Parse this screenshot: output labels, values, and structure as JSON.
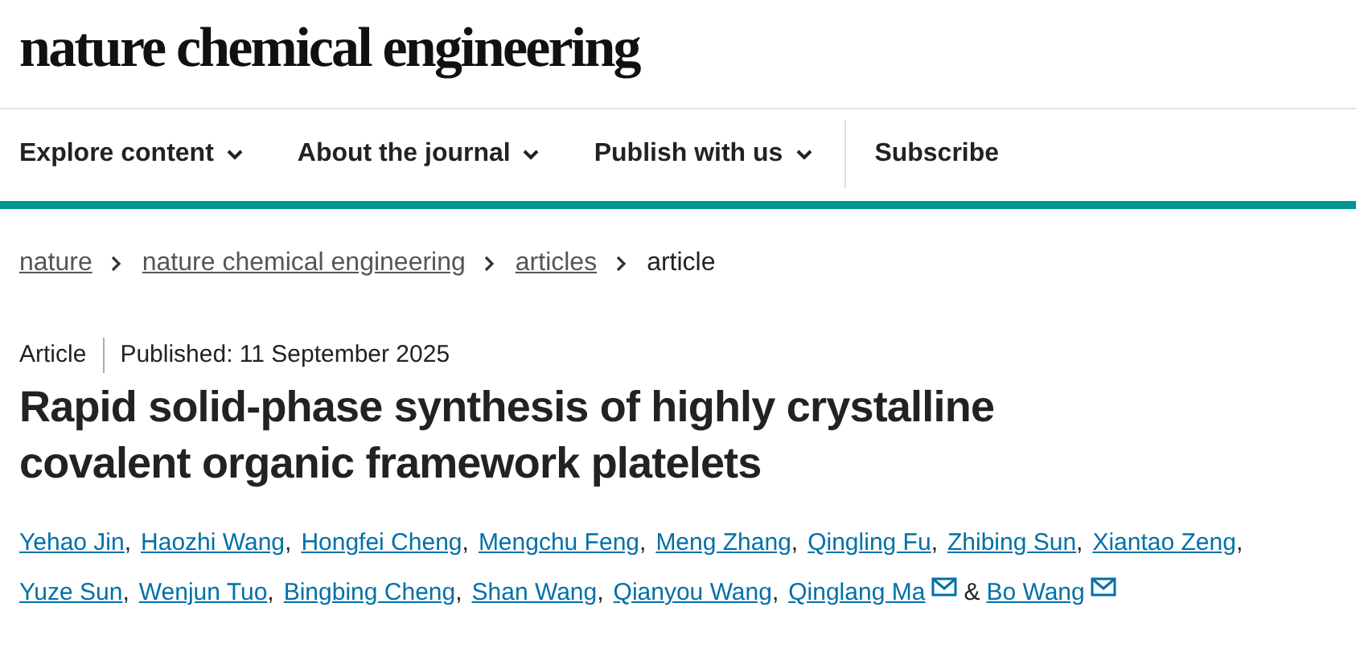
{
  "logo": "nature chemical engineering",
  "nav": [
    {
      "label": "Explore content",
      "kind": "dropdown"
    },
    {
      "label": "About the journal",
      "kind": "dropdown"
    },
    {
      "label": "Publish with us",
      "kind": "dropdown"
    },
    {
      "label": "Subscribe",
      "kind": "link"
    }
  ],
  "breadcrumbs": [
    {
      "label": "nature",
      "kind": "link"
    },
    {
      "label": "nature chemical engineering",
      "kind": "link"
    },
    {
      "label": "articles",
      "kind": "link"
    },
    {
      "label": "article",
      "kind": "current"
    }
  ],
  "article": {
    "type": "Article",
    "published": "Published: 11 September 2025",
    "title": "Rapid solid-phase synthesis of highly crystalline covalent organic framework platelets",
    "authors": [
      {
        "name": "Yehao Jin",
        "corresponding": false
      },
      {
        "name": "Haozhi Wang",
        "corresponding": false
      },
      {
        "name": "Hongfei Cheng",
        "corresponding": false
      },
      {
        "name": "Mengchu Feng",
        "corresponding": false
      },
      {
        "name": "Meng Zhang",
        "corresponding": false
      },
      {
        "name": "Qingling Fu",
        "corresponding": false
      },
      {
        "name": "Zhibing Sun",
        "corresponding": false
      },
      {
        "name": "Xiantao Zeng",
        "corresponding": false
      },
      {
        "name": "Yuze Sun",
        "corresponding": false
      },
      {
        "name": "Wenjun Tuo",
        "corresponding": false
      },
      {
        "name": "Bingbing Cheng",
        "corresponding": false
      },
      {
        "name": "Shan Wang",
        "corresponding": false
      },
      {
        "name": "Qianyou Wang",
        "corresponding": false
      },
      {
        "name": "Qinglang Ma",
        "corresponding": true
      },
      {
        "name": "Bo Wang",
        "corresponding": true
      }
    ],
    "separator": ",",
    "conjunction": "&"
  }
}
